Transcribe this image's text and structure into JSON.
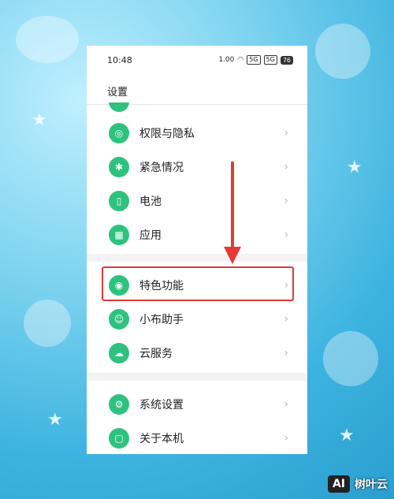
{
  "status_bar": {
    "time": "10:48",
    "net_speed": "1.00",
    "sim1": "5G",
    "sim2": "5G",
    "battery": "76"
  },
  "header": {
    "title": "设置"
  },
  "settings_list": [
    {
      "label": "权限与隐私",
      "icon": "shield-lock-icon"
    },
    {
      "label": "紧急情况",
      "icon": "asterisk-icon"
    },
    {
      "label": "电池",
      "icon": "battery-icon"
    },
    {
      "label": "应用",
      "icon": "grid-icon"
    },
    {
      "label": "特色功能",
      "icon": "star-badge-icon",
      "highlighted": true
    },
    {
      "label": "小布助手",
      "icon": "assistant-icon"
    },
    {
      "label": "云服务",
      "icon": "cloud-icon"
    },
    {
      "label": "系统设置",
      "icon": "gear-icon"
    },
    {
      "label": "关于本机",
      "icon": "phone-icon"
    }
  ],
  "annotation": {
    "arrow_color": "#e53935",
    "highlight_color": "#e53935"
  },
  "watermark": {
    "badge": "AI",
    "text": "树叶云"
  },
  "colors": {
    "icon_accent": "#2ec27e"
  }
}
